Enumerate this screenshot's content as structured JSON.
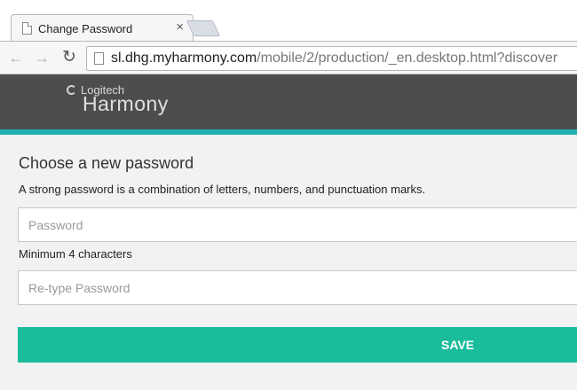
{
  "browser": {
    "tab_title": "Change Password",
    "tab_close": "×",
    "url_host": "sl.dhg.myharmony.com",
    "url_path": "/mobile/2/production/_en.desktop.html?discover",
    "back_glyph": "←",
    "forward_glyph": "→",
    "reload_glyph": "↻"
  },
  "header": {
    "brand": "Logitech",
    "product": "Harmony",
    "accent_color": "#1fb0b3",
    "bar_color": "#4d4d4d"
  },
  "form": {
    "title": "Choose a new password",
    "description": "A strong password is a combination of letters, numbers, and punctuation marks.",
    "password_placeholder": "Password",
    "password_hint": "Minimum 4 characters",
    "retype_placeholder": "Re-type Password",
    "save_label": "SAVE",
    "save_color": "#1bbc9b"
  }
}
